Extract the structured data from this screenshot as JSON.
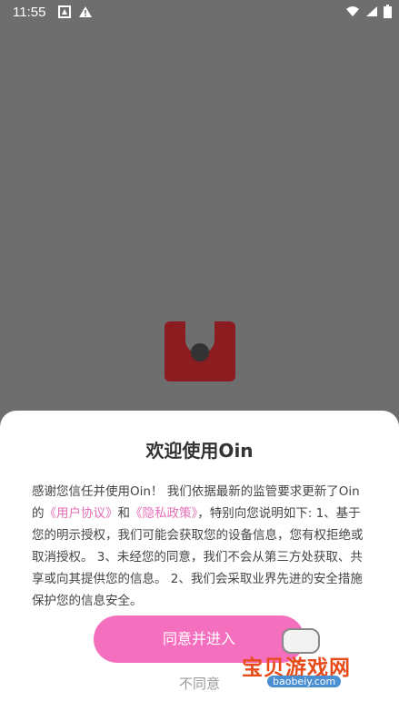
{
  "status": {
    "time": "11:55"
  },
  "dialog": {
    "title": "欢迎使用Oin",
    "p1_a": "感谢您信任并使用Oin！ 我们依据最新的监管要求更新了Oin的",
    "link_user": "《用户协议》",
    "p1_and": "和",
    "link_privacy": "《隐私政策》",
    "p1_b": "，特别向您说明如下: 1、基于您的明示授权，我们可能会获取您的设备信息，您有权拒绝或取消授权。 3、未经您的同意，我们不会从第三方处获取、共享或向其提供您的信息。 2、我们会采取业界先进的安全措施保护您的信息安全。",
    "agree_label": "同意并进入",
    "disagree_label": "不同意"
  },
  "watermark": {
    "text": "宝贝游戏网",
    "url": "baobeiy.com"
  },
  "colors": {
    "accent": "#f56fbf",
    "link": "#e66fb6",
    "overlay": "#6e6e6e"
  }
}
